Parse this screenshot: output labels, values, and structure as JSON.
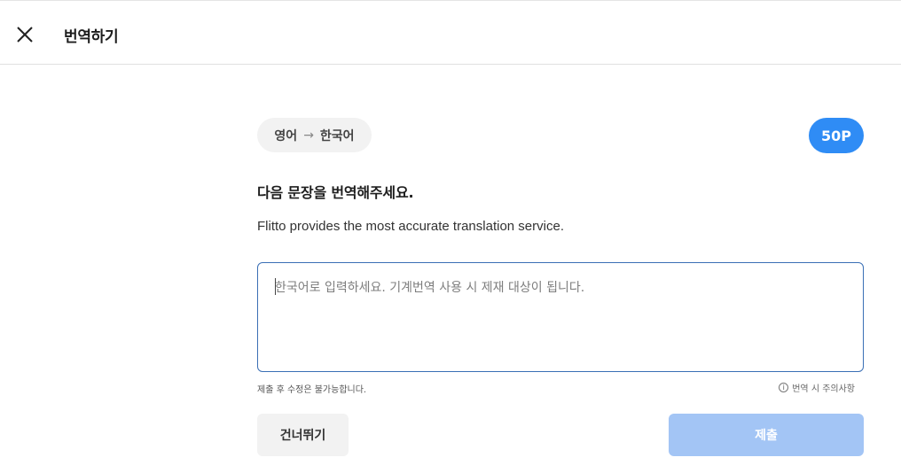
{
  "header": {
    "title": "번역하기",
    "close_icon": "close-icon"
  },
  "task": {
    "source_language": "영어",
    "arrow": "→",
    "target_language": "한국어",
    "points": "50P",
    "instruction": "다음 문장을 번역해주세요.",
    "source_text": "Flitto provides the most accurate translation service."
  },
  "input": {
    "value": "",
    "placeholder": "한국어로 입력하세요. 기계번역 사용 시 제재 대상이 됩니다."
  },
  "notes": {
    "left": "제출 후 수정은 불가능합니다.",
    "right": "번역 시 주의사항",
    "right_icon": "info-icon"
  },
  "actions": {
    "skip_label": "건너뛰기",
    "submit_label": "제출"
  },
  "colors": {
    "accent": "#2f8cf5",
    "submit_disabled": "#a3c5f5",
    "input_border": "#3a6fb5"
  }
}
